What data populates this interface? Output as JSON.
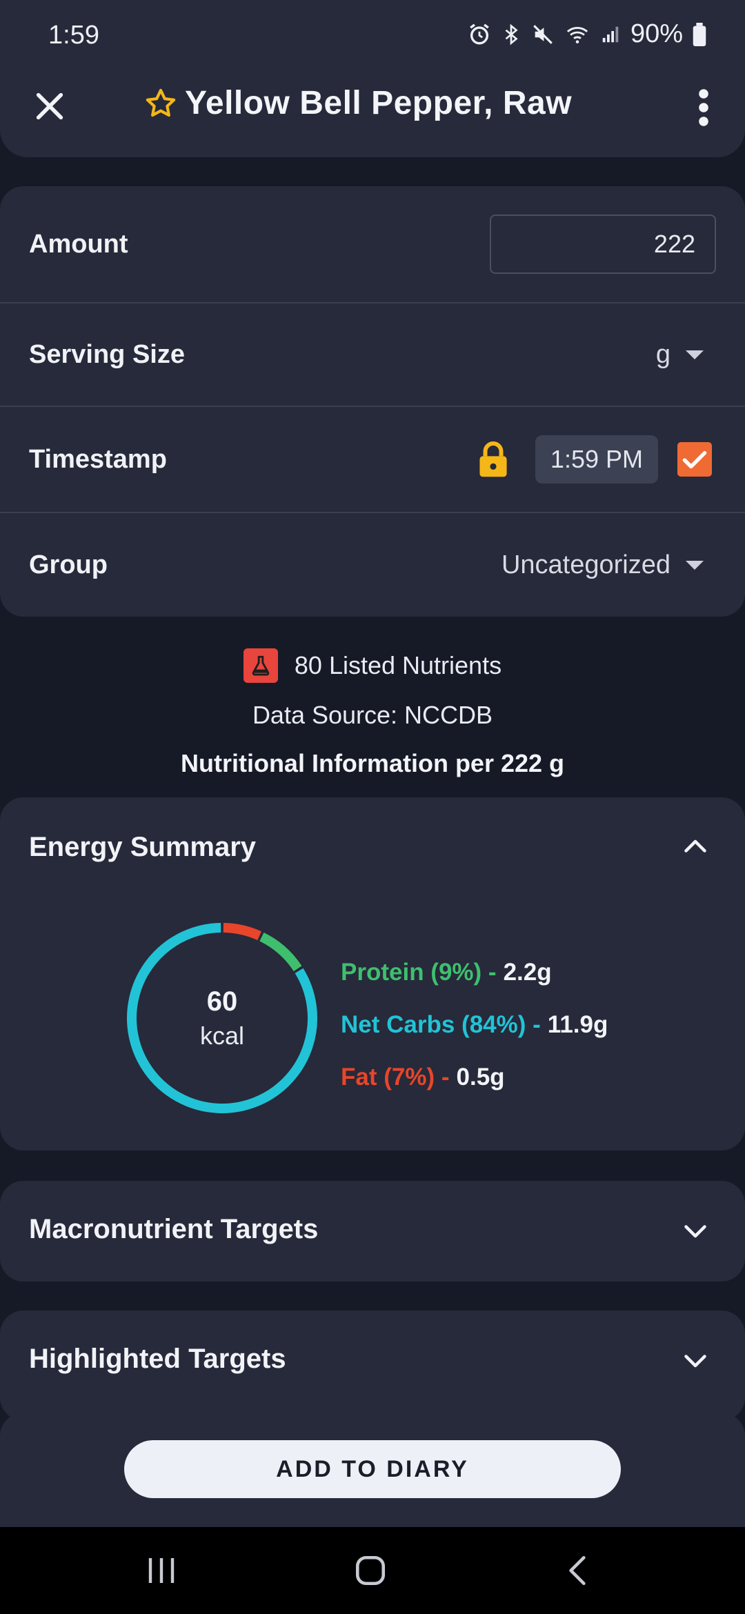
{
  "status_bar": {
    "time": "1:59",
    "battery": "90%"
  },
  "header": {
    "title": "Yellow Bell Pepper, Raw"
  },
  "form": {
    "amount_label": "Amount",
    "amount_value": "222",
    "serving_label": "Serving Size",
    "serving_value": "g",
    "timestamp_label": "Timestamp",
    "timestamp_value": "1:59 PM",
    "timestamp_checked": true,
    "group_label": "Group",
    "group_value": "Uncategorized"
  },
  "info": {
    "nutrients": "80 Listed Nutrients",
    "source": "Data Source: NCCDB",
    "per": "Nutritional Information per 222 g"
  },
  "energy": {
    "title": "Energy Summary",
    "kcal": "60",
    "unit": "kcal",
    "protein_label": "Protein (9%) -",
    "protein_value": "2.2g",
    "carbs_label": "Net Carbs (84%) -",
    "carbs_value": "11.9g",
    "fat_label": "Fat (7%) -",
    "fat_value": "0.5g",
    "colors": {
      "protein": "#3fbf6e",
      "carbs": "#22c3d6",
      "fat": "#e8452a"
    }
  },
  "chart_data": {
    "type": "pie",
    "categories": [
      "Fat",
      "Protein",
      "Net Carbs"
    ],
    "values": [
      7,
      9,
      84
    ]
  },
  "sections": {
    "macro_title": "Macronutrient Targets",
    "highlighted_title": "Highlighted Targets"
  },
  "actions": {
    "add_label": "ADD TO DIARY"
  }
}
